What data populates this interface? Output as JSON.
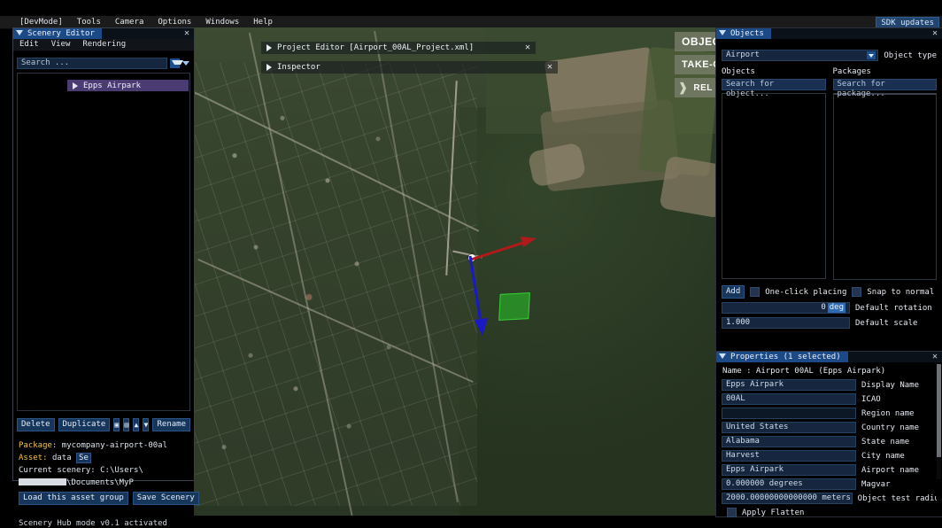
{
  "topbar": {
    "items": [
      "[DevMode]",
      "Tools",
      "Camera",
      "Options",
      "Windows",
      "Help"
    ],
    "sdk_updates": "SDK updates"
  },
  "scenery_editor": {
    "title": "Scenery Editor",
    "close_icon": "✕",
    "menu": [
      "Edit",
      "View",
      "Rendering"
    ],
    "search_placeholder": "Search ...",
    "filter_icon": "filter-icon",
    "tree": [
      {
        "label": "Epps Airpark",
        "expand_icon": "play-triangle-icon"
      }
    ],
    "buttons": {
      "delete": "Delete",
      "duplicate": "Duplicate",
      "import": "▣",
      "export": "▤",
      "move_up": "▲",
      "move_down": "▼",
      "rename": "Rename"
    },
    "info": {
      "package_label": "Package:",
      "package_value": "mycompany-airport-00al",
      "asset_label": "Asset:",
      "asset_value": "data",
      "select_btn": "Se",
      "current_scenery_label": "Current scenery:",
      "current_scenery_prefix": "C:\\Users\\",
      "current_scenery_suffix": "\\Documents\\MyP"
    },
    "actions": {
      "load": "Load this asset group",
      "save": "Save Scenery"
    },
    "status": "Scenery Hub mode v0.1 activated"
  },
  "viewport": {
    "project_editor": {
      "title": "Project Editor [Airport_00AL_Project.xml]",
      "close_icon": "✕",
      "expand_icon": "play-triangle-icon"
    },
    "inspector": {
      "title": "Inspector",
      "close_icon": "✕",
      "expand_icon": "play-triangle-icon"
    },
    "gizmo": {
      "x_axis_color": "#b2191b",
      "z_axis_color": "#1919c8",
      "handle_color": "#fbfbfb",
      "selection_color": "#28c828"
    }
  },
  "hud": {
    "objective": "OBJEC",
    "task": "TAKE-O",
    "action": "REL",
    "chevron_icon": "chevron-right-icon"
  },
  "objects_panel": {
    "title": "Objects",
    "close_icon": "✕",
    "object_type_value": "Airport",
    "object_type_label": "Object type",
    "objects_column_label": "Objects",
    "objects_search_placeholder": "Search for object...",
    "packages_column_label": "Packages",
    "packages_search_placeholder": "Search for package...",
    "add_button": "Add",
    "one_click_placing_label": "One-click placing",
    "snap_to_normal_label": "Snap to normal",
    "default_rotation_value": "0",
    "default_rotation_unit": "deg",
    "default_rotation_label": "Default rotation",
    "default_scale_value": "1.000",
    "default_scale_label": "Default scale"
  },
  "properties_panel": {
    "title": "Properties (1 selected)",
    "close_icon": "✕",
    "name_line": "Name : Airport 00AL (Epps Airpark)",
    "rows": [
      {
        "value": "Epps Airpark",
        "label": "Display Name"
      },
      {
        "value": "00AL",
        "label": "ICAO"
      },
      {
        "value": "",
        "label": "Region name"
      },
      {
        "value": "United States",
        "label": "Country name"
      },
      {
        "value": "Alabama",
        "label": "State name"
      },
      {
        "value": "Harvest",
        "label": "City name"
      },
      {
        "value": "Epps Airpark",
        "label": "Airport name"
      },
      {
        "value": "0.000000 degrees",
        "label": "Magvar"
      },
      {
        "value": "2000.00000000000000 meters",
        "label": "Object test radiu"
      }
    ],
    "apply_flatten_label": "Apply Flatten"
  },
  "colors": {
    "accent_blue": "#1c4a86",
    "field_blue": "#16263e",
    "tree_selection": "#4a3c73",
    "yellow_label": "#f2c33c",
    "panel_black": "#000000"
  }
}
